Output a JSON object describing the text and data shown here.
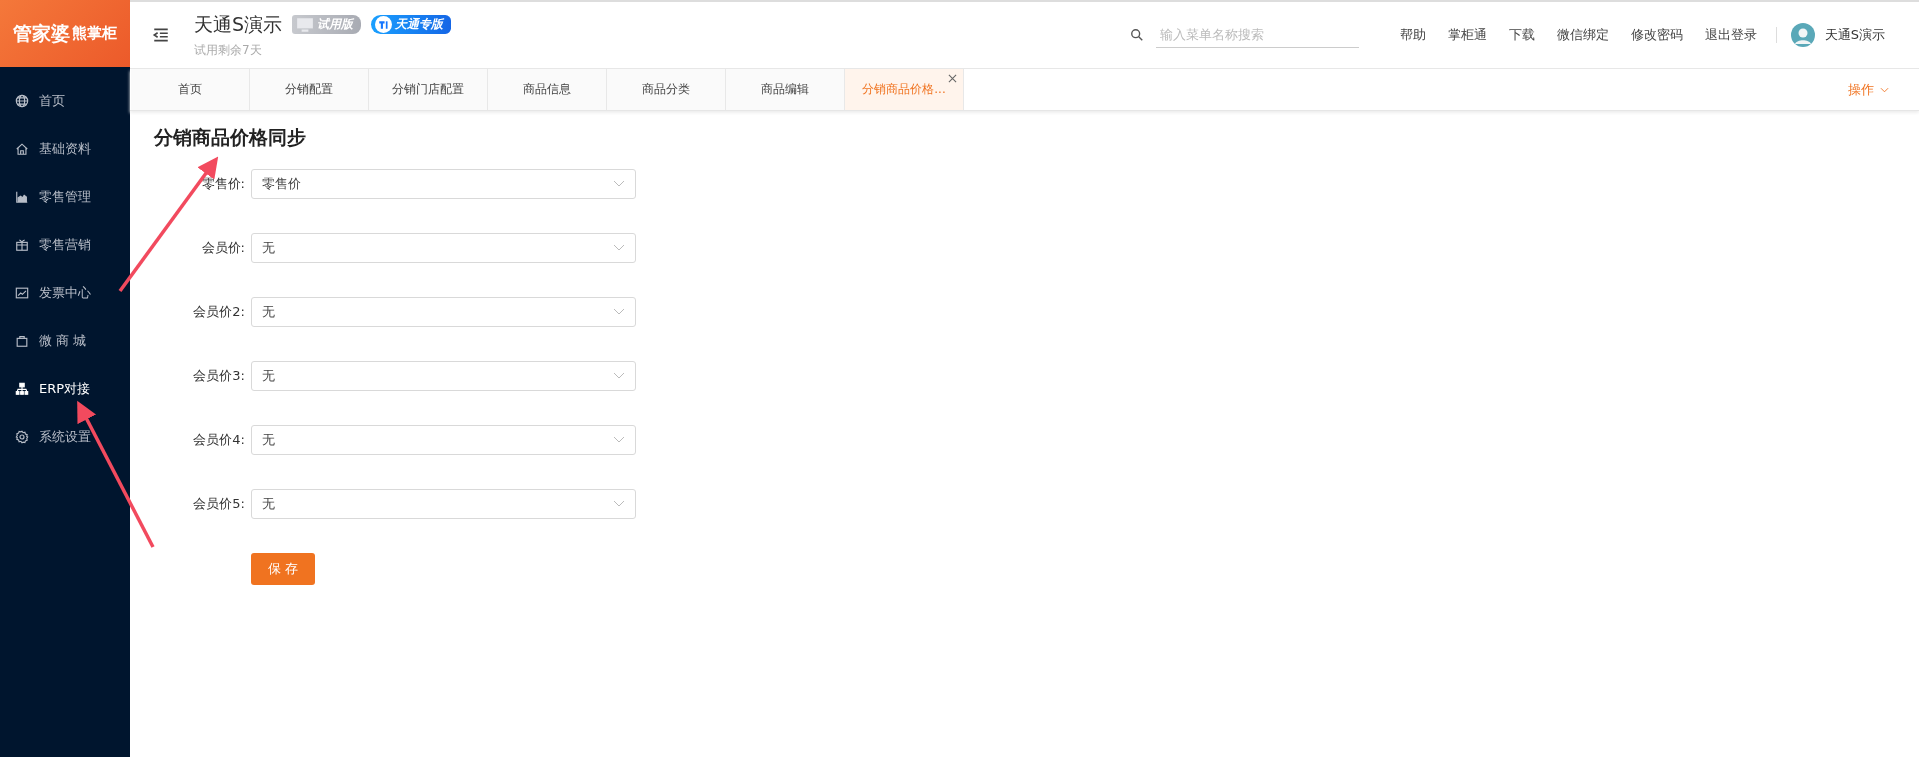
{
  "logo": {
    "brand": "管家婆",
    "product": "熊掌柜"
  },
  "sidebar": {
    "items": [
      {
        "label": "首页",
        "kind": "globe",
        "selected": false
      },
      {
        "label": "基础资料",
        "kind": "home",
        "selected": false
      },
      {
        "label": "零售管理",
        "kind": "chart",
        "selected": false
      },
      {
        "label": "零售营销",
        "kind": "gift",
        "selected": false
      },
      {
        "label": "发票中心",
        "kind": "trend",
        "selected": false
      },
      {
        "label": "微 商 城",
        "kind": "bag",
        "selected": false
      },
      {
        "label": "ERP对接",
        "kind": "network",
        "selected": true
      },
      {
        "label": "系统设置",
        "kind": "gear",
        "selected": false
      }
    ]
  },
  "header": {
    "company": "天通S演示",
    "trial_badge": "试用版",
    "edition_badge": "天通专版",
    "trial_note": "试用剩余7天",
    "search": {
      "placeholder": "输入菜单名称搜索"
    },
    "links": [
      "帮助",
      "掌柜通",
      "下载",
      "微信绑定",
      "修改密码",
      "退出登录"
    ],
    "user": "天通S演示"
  },
  "tabs": [
    {
      "label": "首页",
      "selected": false,
      "closable": false
    },
    {
      "label": "分销配置",
      "selected": false,
      "closable": false
    },
    {
      "label": "分销门店配置",
      "selected": false,
      "closable": false
    },
    {
      "label": "商品信息",
      "selected": false,
      "closable": false
    },
    {
      "label": "商品分类",
      "selected": false,
      "closable": false
    },
    {
      "label": "商品编辑",
      "selected": false,
      "closable": false
    },
    {
      "label": "分销商品价格...",
      "selected": true,
      "closable": true
    }
  ],
  "tab_actions": "操作",
  "page": {
    "title": "分销商品价格同步",
    "fields": [
      {
        "label": "零售价:",
        "value": "零售价"
      },
      {
        "label": "会员价:",
        "value": "无"
      },
      {
        "label": "会员价2:",
        "value": "无"
      },
      {
        "label": "会员价3:",
        "value": "无"
      },
      {
        "label": "会员价4:",
        "value": "无"
      },
      {
        "label": "会员价5:",
        "value": "无"
      }
    ],
    "save": "保 存"
  }
}
